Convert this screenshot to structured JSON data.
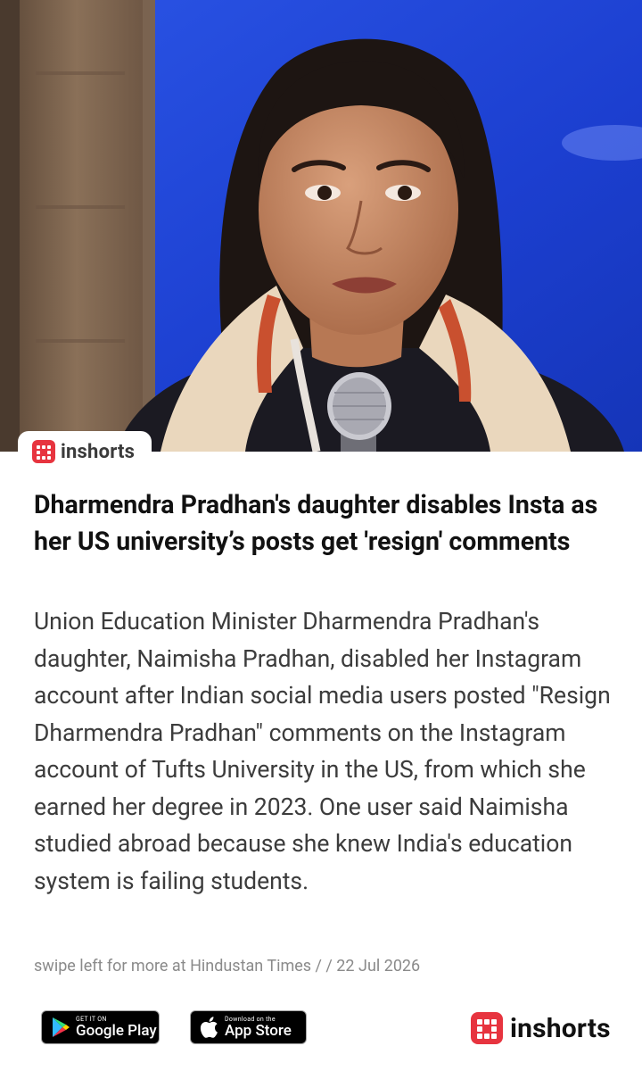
{
  "brand": {
    "name": "inshorts",
    "accent": "#e7343f"
  },
  "article": {
    "headline": "Dharmendra Pradhan's daughter disables Insta as her US university’s posts get 'resign' comments",
    "body": "Union Education Minister Dharmendra Pradhan's daughter, Naimisha Pradhan, disabled her Instagram account after Indian social media users posted \"Resign Dharmendra Pradhan\" comments on the Instagram account of Tufts University in the US, from which she earned her degree in 2023. One user said Naimisha studied abroad because she knew India's education system is failing students.",
    "source_line": "swipe left for more at Hindustan Times /  / 22 Jul 2026"
  },
  "footer": {
    "google_play": {
      "top": "GET IT ON",
      "bottom": "Google Play"
    },
    "app_store": {
      "top": "Download on the",
      "bottom": "App Store"
    },
    "brand_name": "inshorts"
  }
}
